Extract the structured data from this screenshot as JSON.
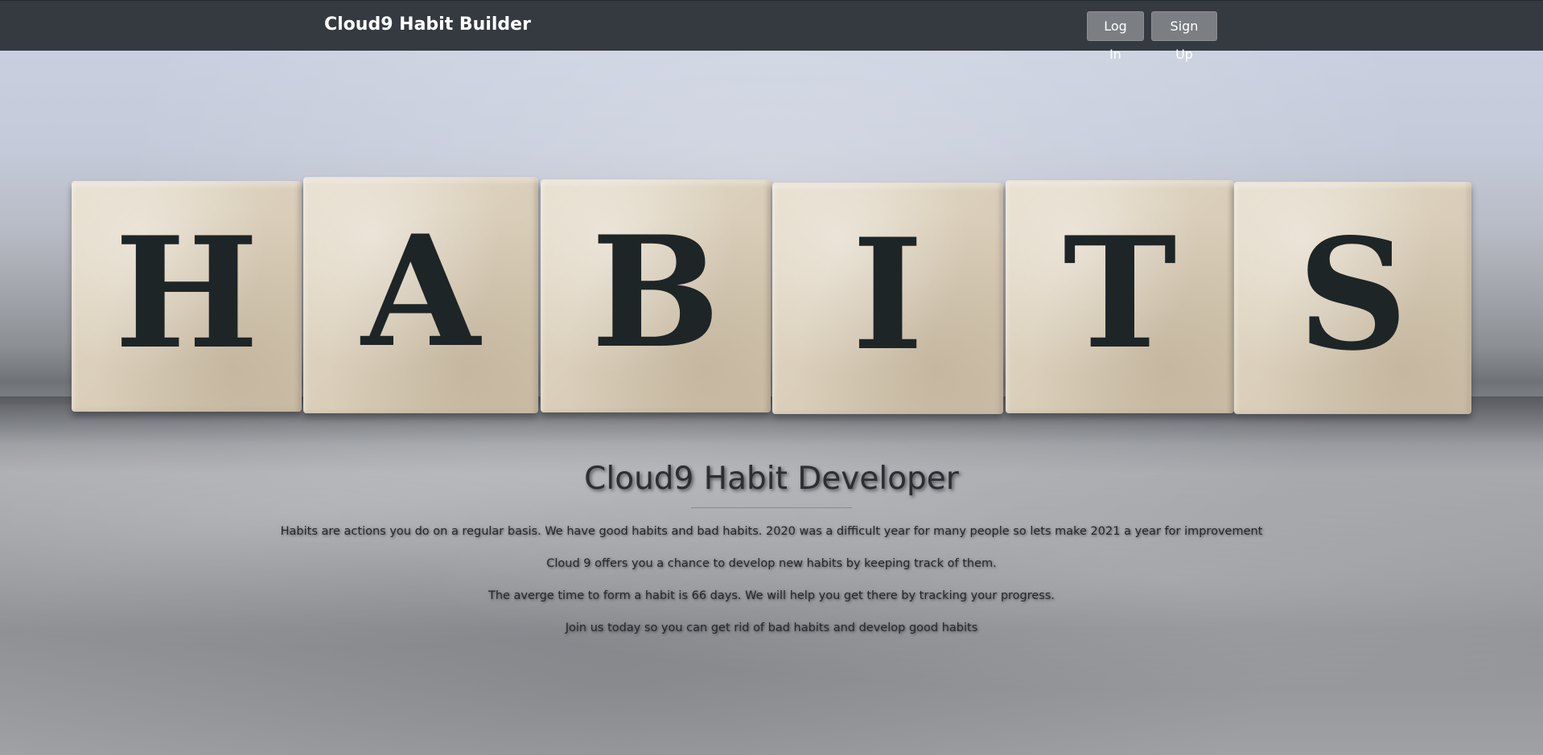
{
  "navbar": {
    "brand": "Cloud9 Habit Builder",
    "login_label": "Log In",
    "signup_label": "Sign Up"
  },
  "hero": {
    "blocks": [
      "H",
      "A",
      "B",
      "I",
      "T",
      "S"
    ]
  },
  "main": {
    "heading": "Cloud9 Habit Developer",
    "paragraphs": [
      "Habits are actions you do on a regular basis. We have good habits and bad habits. 2020 was a difficult year for many people so lets make 2021 a year for improvement",
      "Cloud 9 offers you a chance to develop new habits by keeping track of them.",
      "The averge time to form a habit is 66 days. We will help you get there by tracking your progress.",
      "Join us today so you can get rid of bad habits and develop good habits"
    ]
  },
  "colors": {
    "navbar_bg": "#343a40",
    "button_bg": "#7b7e82",
    "block_letter": "#1e2527"
  }
}
